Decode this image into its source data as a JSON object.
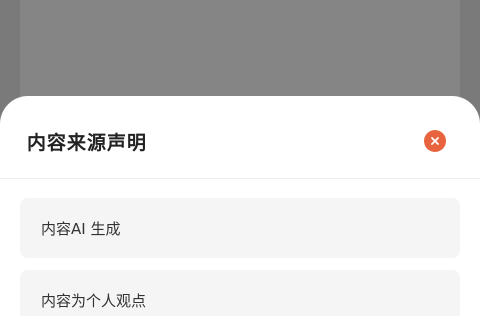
{
  "sheet": {
    "title": "内容来源声明",
    "options": [
      {
        "label": "内容AI 生成"
      },
      {
        "label": "内容为个人观点"
      }
    ]
  },
  "icons": {
    "close": "close-icon"
  },
  "colors": {
    "accent": "#e8643f",
    "overlay": "#7a7a7a",
    "option_bg": "#f5f5f5"
  }
}
